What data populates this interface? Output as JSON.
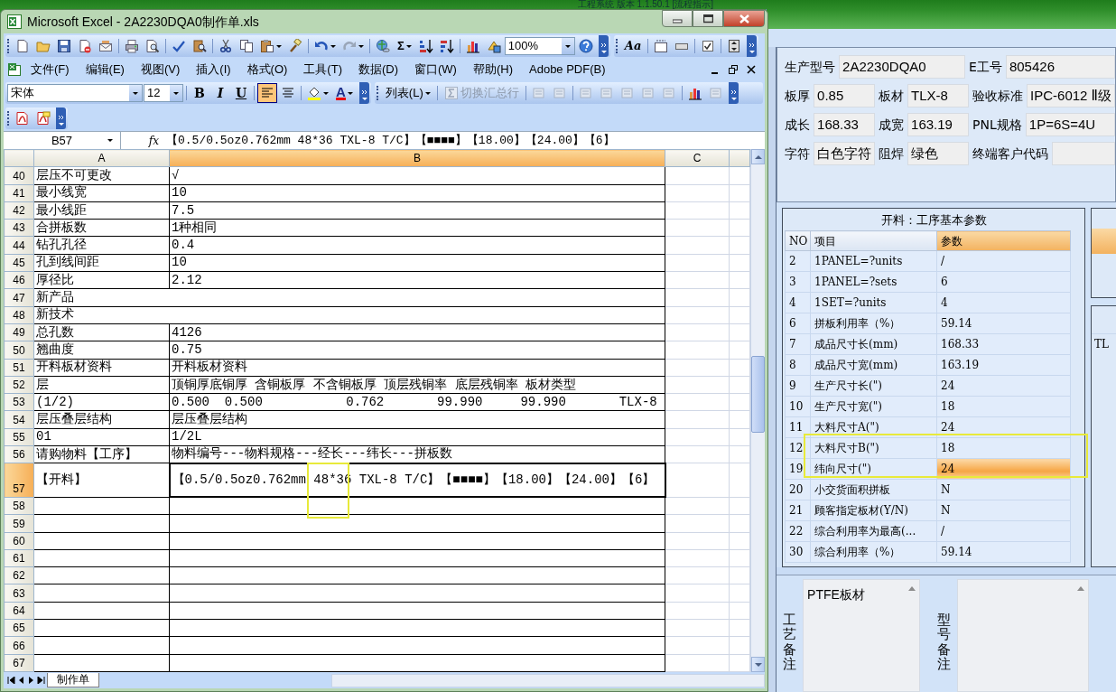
{
  "desktop": {
    "background_title": "工程系统 版本 1.1.50.1 [流程指示]"
  },
  "excel": {
    "title": "Microsoft Excel - 2A2230DQA0制作单.xls",
    "standard_toolbar": {
      "sum": "Σ",
      "zoom": "100%"
    },
    "aux_toolbar": {
      "font_style": "Aa"
    },
    "menu": [
      "文件(F)",
      "编辑(E)",
      "视图(V)",
      "插入(I)",
      "格式(O)",
      "工具(T)",
      "数据(D)",
      "窗口(W)",
      "帮助(H)",
      "Adobe PDF(B)"
    ],
    "format_toolbar": {
      "font": "宋体",
      "size": "12",
      "buttons": [
        {
          "kind": "bold",
          "label": "B",
          "selected": false
        },
        {
          "kind": "italic",
          "label": "I",
          "selected": false
        },
        {
          "kind": "underline",
          "label": "U",
          "selected": false
        },
        {
          "kind": "align-left",
          "selected": true
        },
        {
          "kind": "align-center",
          "selected": false
        }
      ],
      "font_color": "A",
      "list_button": "列表(L)",
      "total_row_button": {
        "label": "切换汇总行",
        "disabled": true
      }
    },
    "name_box": "B57",
    "fx": "fx",
    "formula": "【0.5/0.5oz0.762mm 48*36 TXL-8 T/C】【■■■■】【18.00】【24.00】【6】",
    "columns": [
      {
        "label": "A",
        "selected": false
      },
      {
        "label": "B",
        "selected": true
      },
      {
        "label": "C",
        "selected": false
      }
    ],
    "rows": [
      {
        "num": "40",
        "a": "层压不可更改",
        "b": "√",
        "merged": false,
        "selected": false
      },
      {
        "num": "41",
        "a": "最小线宽",
        "b": "10",
        "merged": false,
        "selected": false
      },
      {
        "num": "42",
        "a": "最小线距",
        "b": "7.5",
        "merged": false,
        "selected": false
      },
      {
        "num": "43",
        "a": "合拼板数",
        "b": "1种相同",
        "merged": false,
        "selected": false
      },
      {
        "num": "44",
        "a": "钻孔孔径",
        "b": "0.4",
        "merged": false,
        "selected": false
      },
      {
        "num": "45",
        "a": "孔到线间距",
        "b": "10",
        "merged": false,
        "selected": false
      },
      {
        "num": "46",
        "a": "厚径比",
        "b": "2.12",
        "merged": false,
        "selected": false
      },
      {
        "num": "47",
        "a": "新产品",
        "merged": true,
        "selected": false
      },
      {
        "num": "48",
        "a": "新技术",
        "merged": true,
        "selected": false
      },
      {
        "num": "49",
        "a": "总孔数",
        "b": "4126",
        "merged": false,
        "selected": false
      },
      {
        "num": "50",
        "a": "翘曲度",
        "b": "0.75",
        "merged": false,
        "selected": false
      },
      {
        "num": "51",
        "a": "开料板材资料",
        "b": "开料板材资料",
        "merged": false,
        "selected": false
      },
      {
        "num": "52",
        "a": "层",
        "b": "顶铜厚底铜厚 含铜板厚 不含铜板厚 顶层残铜率 底层残铜率 板材类型",
        "merged": false,
        "selected": false
      },
      {
        "num": "53",
        "a": "(1/2)",
        "b": "0.500  0.500           0.762       99.990     99.990       TLX-8",
        "merged": false,
        "selected": false
      },
      {
        "num": "54",
        "a": "层压叠层结构",
        "b": "层压叠层结构",
        "merged": false,
        "selected": false
      },
      {
        "num": "55",
        "a": "01",
        "b": "1/2L",
        "merged": false,
        "selected": false
      },
      {
        "num": "56",
        "a": "请购物料【工序】",
        "b": "物料编号---物料规格---经长---纬长---拼板数",
        "merged": false,
        "selected": false
      },
      {
        "num": "57",
        "a": "【开料】",
        "b": "【0.5/0.5oz0.762mm 48*36 TXL-8 T/C】【■■■■】【18.00】【24.00】【6】",
        "merged": false,
        "selected": true
      },
      {
        "num": "58",
        "merged": false,
        "selected": false
      },
      {
        "num": "59",
        "merged": false,
        "selected": false
      },
      {
        "num": "60",
        "merged": false,
        "selected": false
      },
      {
        "num": "61",
        "merged": false,
        "selected": false
      },
      {
        "num": "62",
        "merged": false,
        "selected": false
      },
      {
        "num": "63",
        "merged": false,
        "selected": false
      },
      {
        "num": "64",
        "merged": false,
        "selected": false
      },
      {
        "num": "65",
        "merged": false,
        "selected": false
      },
      {
        "num": "66",
        "merged": false,
        "selected": false
      },
      {
        "num": "67",
        "merged": false,
        "selected": false
      }
    ],
    "sheet_tabs": [
      {
        "label": "制作单",
        "selected": true
      }
    ]
  },
  "app": {
    "fields": [
      [
        {
          "label": "生产型号",
          "value": "2A2230DQA0"
        },
        {
          "label": "E工号",
          "value": "805426"
        }
      ],
      [
        {
          "label": "板厚",
          "value": "0.85"
        },
        {
          "label": "板材",
          "value": "TLX-8"
        },
        {
          "label": "验收标准",
          "value": "IPC-6012 Ⅱ级"
        }
      ],
      [
        {
          "label": "成长",
          "value": "168.33"
        },
        {
          "label": "成宽",
          "value": "163.19"
        },
        {
          "label": "PNL规格",
          "value": "1P=6S=4U"
        }
      ],
      [
        {
          "label": "字符",
          "value": "白色字符"
        },
        {
          "label": "阻焊",
          "value": "绿色"
        },
        {
          "label": "终端客户代码"
        }
      ]
    ],
    "grid": {
      "title": "开料：工序基本参数",
      "columns": [
        "NO",
        "项目",
        "参数"
      ],
      "rows": [
        {
          "no": "2",
          "item": "1PANEL=?units",
          "value": "/",
          "selected": false
        },
        {
          "no": "3",
          "item": "1PANEL=?sets",
          "value": "6",
          "selected": false
        },
        {
          "no": "4",
          "item": "1SET=?units",
          "value": "4",
          "selected": false
        },
        {
          "no": "6",
          "item": "拼板利用率（%）",
          "value": "59.14",
          "selected": false
        },
        {
          "no": "7",
          "item": "成品尺寸长(mm)",
          "value": "168.33",
          "selected": false
        },
        {
          "no": "8",
          "item": "成品尺寸宽(mm)",
          "value": "163.19",
          "selected": false
        },
        {
          "no": "9",
          "item": "生产尺寸长(\")",
          "value": "24",
          "selected": false
        },
        {
          "no": "10",
          "item": "生产尺寸宽(\")",
          "value": "18",
          "selected": false
        },
        {
          "no": "11",
          "item": "大料尺寸A(\")",
          "value": "24",
          "selected": false
        },
        {
          "no": "12",
          "item": "大料尺寸B(\")",
          "value": "18",
          "selected": false
        },
        {
          "no": "19",
          "item": "纬向尺寸(\")",
          "value": "24",
          "selected": true
        },
        {
          "no": "20",
          "item": "小交货面积拼板",
          "value": "N",
          "selected": false
        },
        {
          "no": "21",
          "item": "顾客指定板材(Y/N)",
          "value": "N",
          "selected": false
        },
        {
          "no": "22",
          "item": "综合利用率为最高(...",
          "value": "/",
          "selected": false
        },
        {
          "no": "30",
          "item": "综合利用率（%）",
          "value": "59.14",
          "selected": false
        }
      ]
    },
    "side_cell": "TL",
    "notes": [
      {
        "label": "工艺备注",
        "text": "PTFE板材"
      },
      {
        "label": "型号备注"
      }
    ]
  }
}
